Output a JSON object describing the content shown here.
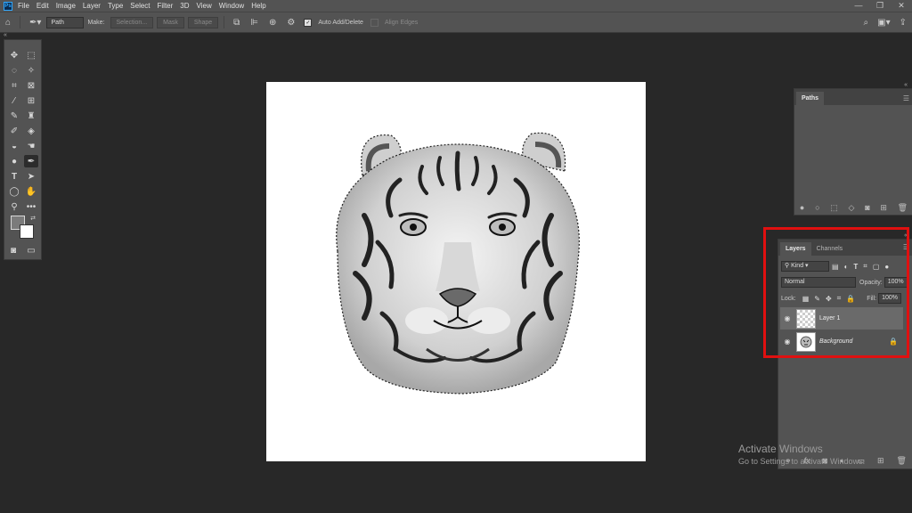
{
  "app": {
    "logo": "Ps"
  },
  "menu": [
    "File",
    "Edit",
    "Image",
    "Layer",
    "Type",
    "Select",
    "Filter",
    "3D",
    "View",
    "Window",
    "Help"
  ],
  "window_controls": [
    "—",
    "❐",
    "✕"
  ],
  "options": {
    "mode_value": "Path",
    "make_label": "Make:",
    "selection_btn": "Selection...",
    "mask_btn": "Mask",
    "shape_btn": "Shape",
    "auto_add_label": "Auto Add/Delete",
    "align_edges_label": "Align Edges"
  },
  "paths_panel": {
    "tab": "Paths"
  },
  "layers_panel": {
    "tabs": [
      "Layers",
      "Channels"
    ],
    "kind_value": "Kind",
    "blend_value": "Normal",
    "opacity_label": "Opacity:",
    "opacity_value": "100%",
    "lock_label": "Lock:",
    "fill_label": "Fill:",
    "fill_value": "100%",
    "layers": [
      {
        "name": "Layer 1",
        "selected": true
      },
      {
        "name": "Background",
        "selected": false,
        "locked": true
      }
    ]
  },
  "watermark": {
    "title": "Activate Windows",
    "subtitle": "Go to Settings to activate Windows."
  },
  "colors": {
    "highlight": "#e01010",
    "foreground": "#7b7b7b",
    "background": "#ffffff"
  }
}
